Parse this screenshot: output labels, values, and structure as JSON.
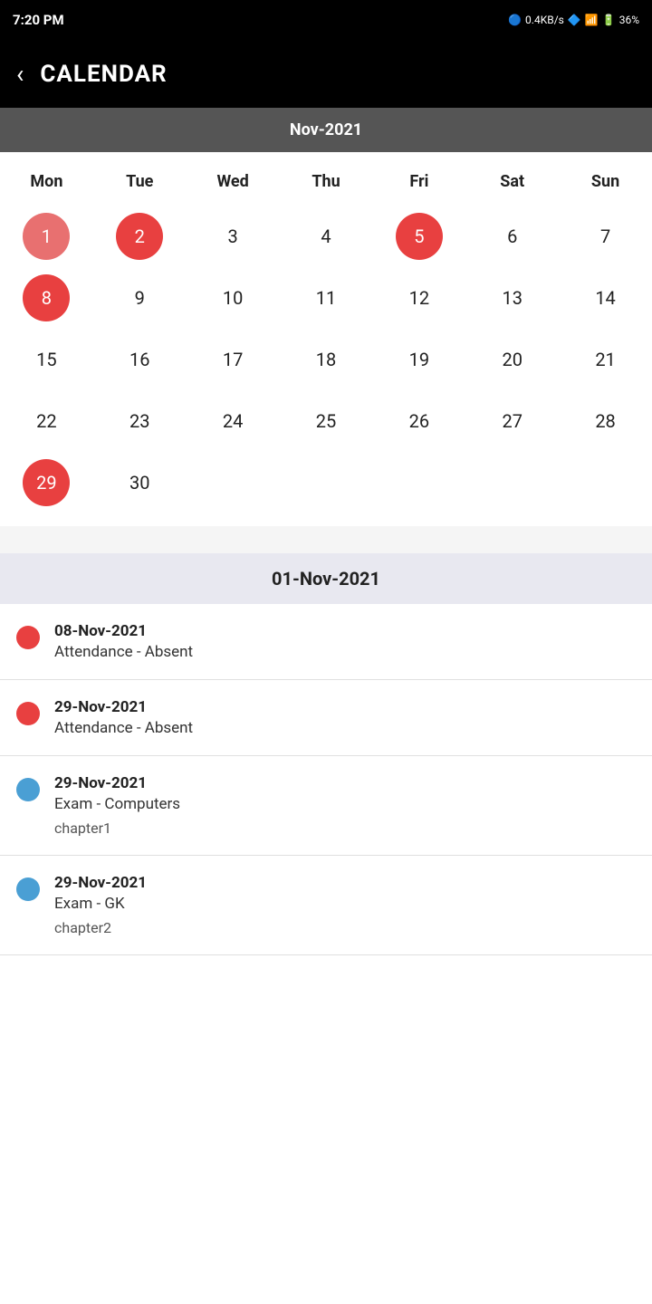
{
  "statusBar": {
    "time": "7:20 PM",
    "network": "0.4KB/s",
    "battery": "36%"
  },
  "header": {
    "back_label": "‹",
    "title": "CALENDAR"
  },
  "calendar": {
    "month_label": "Nov-2021",
    "weekdays": [
      "Mon",
      "Tue",
      "Wed",
      "Thu",
      "Fri",
      "Sat",
      "Sun"
    ],
    "days": [
      {
        "day": "1",
        "style": "circle-red-light"
      },
      {
        "day": "2",
        "style": "circle-red"
      },
      {
        "day": "3",
        "style": "normal"
      },
      {
        "day": "4",
        "style": "normal"
      },
      {
        "day": "5",
        "style": "circle-red"
      },
      {
        "day": "6",
        "style": "normal"
      },
      {
        "day": "7",
        "style": "normal"
      },
      {
        "day": "8",
        "style": "circle-red"
      },
      {
        "day": "9",
        "style": "normal"
      },
      {
        "day": "10",
        "style": "normal"
      },
      {
        "day": "11",
        "style": "normal"
      },
      {
        "day": "12",
        "style": "normal"
      },
      {
        "day": "13",
        "style": "normal"
      },
      {
        "day": "14",
        "style": "normal"
      },
      {
        "day": "15",
        "style": "normal"
      },
      {
        "day": "16",
        "style": "normal"
      },
      {
        "day": "17",
        "style": "normal"
      },
      {
        "day": "18",
        "style": "normal"
      },
      {
        "day": "19",
        "style": "normal"
      },
      {
        "day": "20",
        "style": "normal"
      },
      {
        "day": "21",
        "style": "normal"
      },
      {
        "day": "22",
        "style": "normal"
      },
      {
        "day": "23",
        "style": "normal"
      },
      {
        "day": "24",
        "style": "normal"
      },
      {
        "day": "25",
        "style": "normal"
      },
      {
        "day": "26",
        "style": "normal"
      },
      {
        "day": "27",
        "style": "normal"
      },
      {
        "day": "28",
        "style": "normal"
      },
      {
        "day": "29",
        "style": "circle-red"
      },
      {
        "day": "30",
        "style": "normal"
      },
      {
        "day": "",
        "style": "normal"
      },
      {
        "day": "",
        "style": "normal"
      },
      {
        "day": "",
        "style": "normal"
      },
      {
        "day": "",
        "style": "normal"
      },
      {
        "day": "",
        "style": "normal"
      }
    ]
  },
  "eventSection": {
    "header": "01-Nov-2021",
    "events": [
      {
        "dot": "red",
        "date": "08-Nov-2021",
        "title": "Attendance - Absent",
        "subtitle": ""
      },
      {
        "dot": "red",
        "date": "29-Nov-2021",
        "title": "Attendance - Absent",
        "subtitle": ""
      },
      {
        "dot": "blue",
        "date": "29-Nov-2021",
        "title": "Exam - Computers",
        "subtitle": "chapter1"
      },
      {
        "dot": "blue",
        "date": "29-Nov-2021",
        "title": "Exam - GK",
        "subtitle": "chapter2"
      }
    ]
  }
}
